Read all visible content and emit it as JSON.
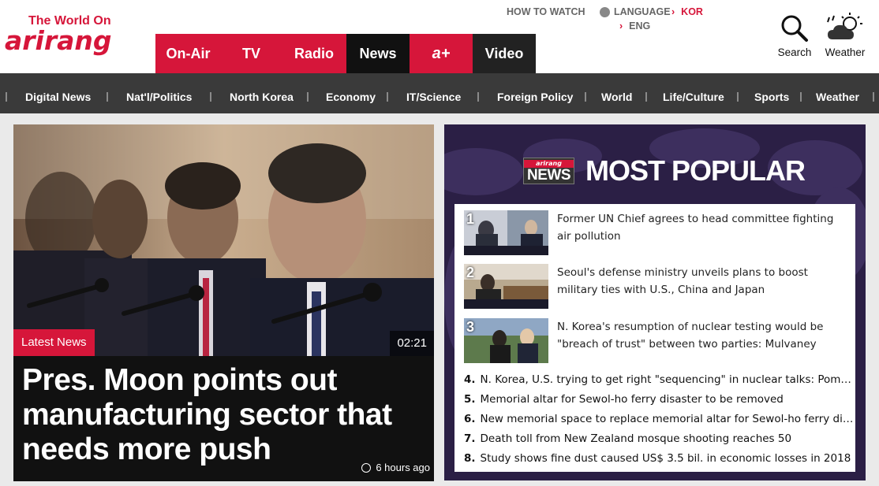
{
  "logo": {
    "top": "The World On",
    "main": "arirang"
  },
  "nav": [
    {
      "label": "On-Air",
      "style": "red"
    },
    {
      "label": "TV",
      "style": "red"
    },
    {
      "label": "Radio",
      "style": "red"
    },
    {
      "label": "News",
      "style": "black"
    },
    {
      "label": "a+",
      "style": "red"
    },
    {
      "label": "Video",
      "style": "grey"
    }
  ],
  "utility": {
    "how_to_watch": "HOW TO WATCH",
    "language": "LANGUAGE",
    "lang_kor": "KOR",
    "lang_eng": "ENG"
  },
  "header_actions": {
    "search": "Search",
    "weather": "Weather"
  },
  "categories": [
    "Digital News",
    "Nat'l/Politics",
    "North Korea",
    "Economy",
    "IT/Science",
    "Foreign Policy",
    "World",
    "Life/Culture",
    "Sports",
    "Weather"
  ],
  "main_story": {
    "tag": "Latest News",
    "duration": "02:21",
    "headline": "Pres. Moon points out manufacturing sector that needs more push",
    "time": "6 hours ago"
  },
  "popular": {
    "badge_top": "arirang",
    "badge_main": "NEWS",
    "title": "MOST POPULAR",
    "items": [
      {
        "num": "1",
        "text": "Former UN Chief agrees to head committee fighting air pollution"
      },
      {
        "num": "2",
        "text": "Seoul's defense ministry unveils plans to boost military ties with U.S., China and Japan"
      },
      {
        "num": "3",
        "text": "N. Korea's resumption of nuclear testing would be \"breach of trust\" between two parties: Mulvaney"
      },
      {
        "num": "4.",
        "text": "N. Korea, U.S. trying to get right \"sequencing\" in nuclear talks: Pompeo"
      },
      {
        "num": "5.",
        "text": "Memorial altar for Sewol-ho ferry disaster to be removed"
      },
      {
        "num": "6.",
        "text": "New memorial space to replace memorial altar for Sewol-ho ferry dis..."
      },
      {
        "num": "7.",
        "text": "Death toll from New Zealand mosque shooting reaches 50"
      },
      {
        "num": "8.",
        "text": "Study shows fine dust caused US$ 3.5 bil. in economic losses in 2018"
      }
    ]
  },
  "colors": {
    "brand_red": "#d6163a",
    "category_bar": "#3a3a3a",
    "popular_bg": "#2b1f45"
  }
}
